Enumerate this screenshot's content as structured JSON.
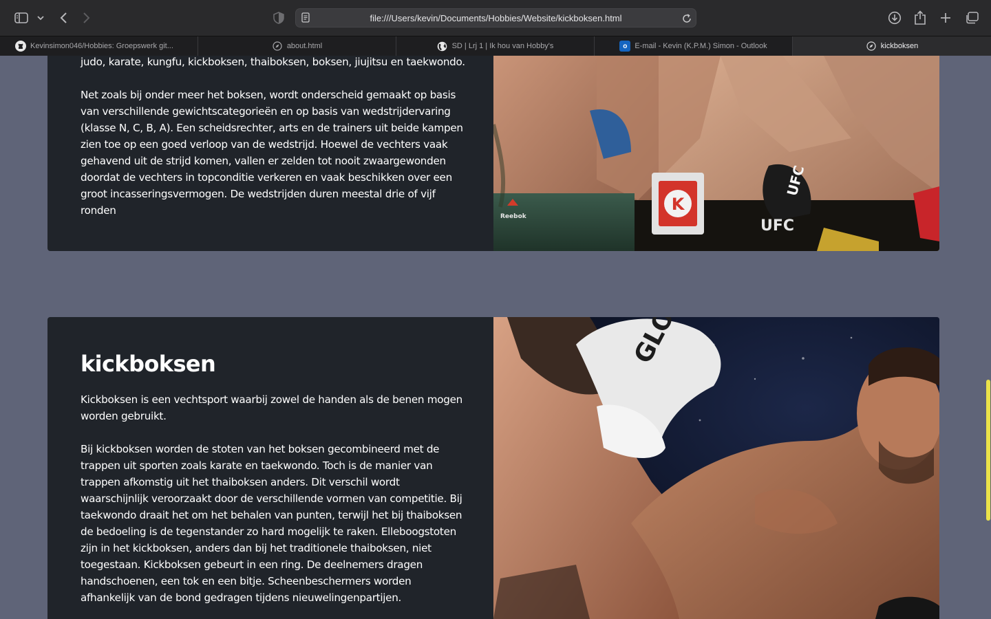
{
  "browser": {
    "url": "file:///Users/kevin/Documents/Hobbies/Website/kickboksen.html",
    "tabs": [
      {
        "label": "Kevinsimon046/Hobbies: Groepswerk git...",
        "icon": "github-icon"
      },
      {
        "label": "about.html",
        "icon": "compass-icon"
      },
      {
        "label": "SD | Lrj 1 | Ik hou van Hobby's",
        "icon": "globe-icon"
      },
      {
        "label": "E-mail - Kevin (K.P.M.) Simon - Outlook",
        "icon": "outlook-icon"
      },
      {
        "label": "kickboksen",
        "icon": "compass-icon",
        "active": true
      }
    ]
  },
  "section1": {
    "paragraphs": [
      "judo, karate, kungfu, kickboksen, thaiboksen, boksen, jiujitsu en taekwondo.",
      "Net zoals bij onder meer het boksen, wordt onderscheid gemaakt op basis van verschillende gewichtscategorieën en op basis van wedstrijdervaring (klasse N, C, B, A). Een scheidsrechter, arts en de trainers uit beide kampen zien toe op een goed verloop van de wedstrijd. Hoewel de vechters vaak gehavend uit de strijd komen, vallen er zelden tot nooit zwaargewonden doordat de vechters in topconditie verkeren en vaak beschikken over een groot incasseringsvermogen. De wedstrijden duren meestal drie of vijf ronden"
    ],
    "image_logos": {
      "brand_a": "UFC",
      "brand_b": "Reebok",
      "sponsor": "K"
    }
  },
  "section2": {
    "title": "kickboksen",
    "paragraphs": [
      "Kickboksen is een vechtsport waarbij zowel de handen als de benen mogen worden gebruikt.",
      "Bij kickboksen worden de stoten van het boksen gecombineerd met de trappen uit sporten zoals karate en taekwondo. Toch is de manier van trappen afkomstig uit het thaiboksen anders. Dit verschil wordt waarschijnlijk veroorzaakt door de verschillende vormen van competitie. Bij taekwondo draait het om het behalen van punten, terwijl het bij thaiboksen de bedoeling is de tegenstander zo hard mogelijk te raken. Elleboogstoten zijn in het kickboksen, anders dan bij het traditionele thaiboksen, niet toegestaan. Kickboksen gebeurt in een ring. De deelnemers dragen handschoenen, een tok en een bitje. Scheenbeschermers worden afhankelijk van de bond gedragen tijdens nieuwelingenpartijen."
    ],
    "image_logo": "GLORY"
  },
  "colors": {
    "page_bg": "#5f6478",
    "card_bg": "#20242a",
    "scroll_thumb": "#eae24a"
  }
}
